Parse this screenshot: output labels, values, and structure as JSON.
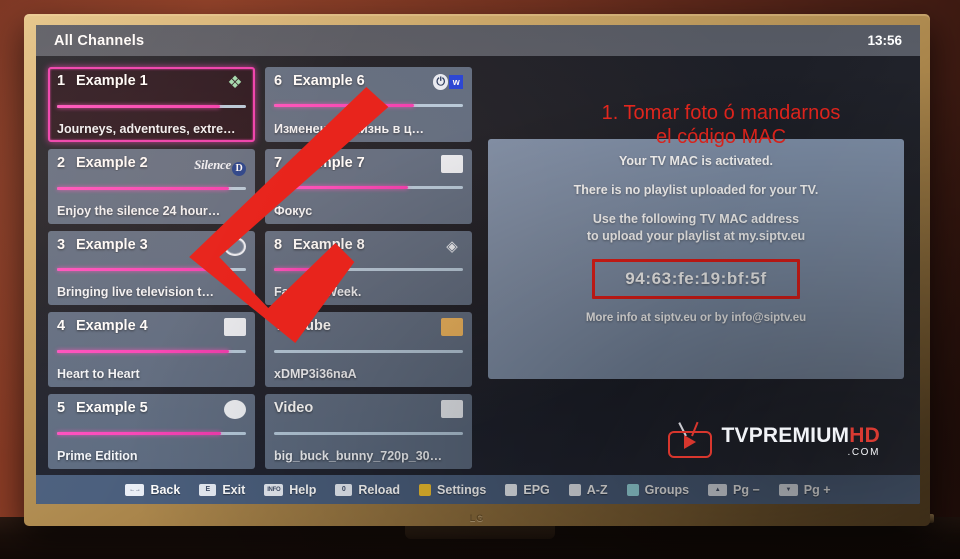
{
  "device": {
    "brand": "LG"
  },
  "topbar": {
    "title": "All Channels",
    "clock": "13:56"
  },
  "channels": [
    {
      "number": "1",
      "name": "Example 1",
      "subtitle": "Journeys, adventures, extre…",
      "progress": 86,
      "logo": "puzzle-icon",
      "selected": true
    },
    {
      "number": "2",
      "name": "Example 2",
      "subtitle": "Enjoy the silence 24 hour…",
      "progress": 91,
      "logo": "silence-logo",
      "selected": false
    },
    {
      "number": "3",
      "name": "Example 3",
      "subtitle": "Bringing live television t…",
      "progress": 91,
      "logo": "ring-icon",
      "selected": false
    },
    {
      "number": "4",
      "name": "Example 4",
      "subtitle": "Heart to Heart",
      "progress": 91,
      "logo": "square-icon",
      "selected": false
    },
    {
      "number": "5",
      "name": "Example 5",
      "subtitle": "Prime Edition",
      "progress": 87,
      "logo": "dot-icon",
      "selected": false
    },
    {
      "number": "6",
      "name": "Example 6",
      "subtitle": "Изменение. Жизнь в ц…",
      "progress": 74,
      "logo": "ow-logo",
      "selected": false
    },
    {
      "number": "7",
      "name": "Example 7",
      "subtitle": "Фокус",
      "progress": 71,
      "logo": "square-icon",
      "selected": false
    },
    {
      "number": "8",
      "name": "Example 8",
      "subtitle": "Fashion Week.",
      "progress": 21,
      "logo": "diamond-icon",
      "selected": false
    },
    {
      "number": "",
      "name": "Youtube",
      "subtitle": "xDMP3i36naA",
      "progress": 0,
      "logo": "square-orange-icon",
      "selected": false
    },
    {
      "number": "",
      "name": "Video",
      "subtitle": "big_buck_bunny_720p_30…",
      "progress": 0,
      "logo": "square-icon",
      "selected": false
    }
  ],
  "info_panel": {
    "line1": "Your TV MAC is activated.",
    "line2": "There is no playlist uploaded for your TV.",
    "line3a": "Use the following TV MAC address",
    "line3b": "to upload your playlist at my.siptv.eu",
    "mac_address": "94:63:fe:19:bf:5f",
    "footer": "More info at siptv.eu or by info@siptv.eu"
  },
  "brand": {
    "main_white": "TVPREMIUM",
    "main_red": "HD",
    "domain": ".COM"
  },
  "hints": [
    {
      "label": "Back",
      "key_glyph": "←→",
      "key_class": "key wide"
    },
    {
      "label": "Exit",
      "key_glyph": "E",
      "key_class": "key"
    },
    {
      "label": "Help",
      "key_glyph": "INFO",
      "key_class": "key wide"
    },
    {
      "label": "Reload",
      "key_glyph": "0",
      "key_class": "key"
    },
    {
      "label": "Settings",
      "key_glyph": "",
      "key_class": "key sq c-yellow"
    },
    {
      "label": "EPG",
      "key_glyph": "",
      "key_class": "key sq c-white"
    },
    {
      "label": "A-Z",
      "key_glyph": "",
      "key_class": "key sq c-white"
    },
    {
      "label": "Groups",
      "key_glyph": "",
      "key_class": "key sq c-cyan"
    },
    {
      "label": "Pg −",
      "key_glyph": "▲",
      "key_class": "key wide"
    },
    {
      "label": "Pg +",
      "key_glyph": "▼",
      "key_class": "key wide"
    }
  ],
  "annotation": {
    "line1": "1. Tomar foto ó mandarnos",
    "line2": "el código MAC",
    "color": "#e8241c"
  }
}
